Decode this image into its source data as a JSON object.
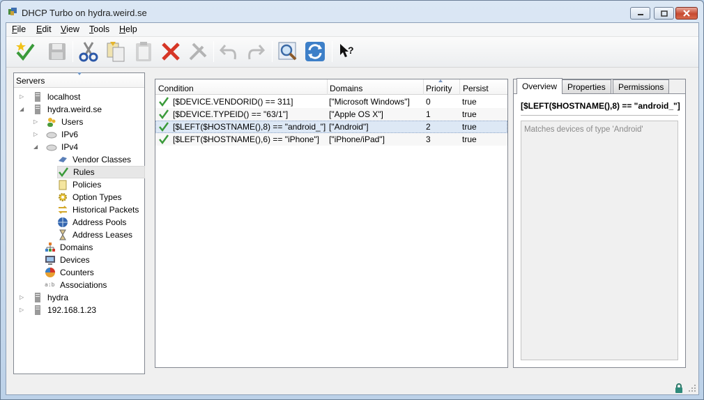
{
  "window": {
    "title": "DHCP Turbo on hydra.weird.se"
  },
  "menu": [
    "File",
    "Edit",
    "View",
    "Tools",
    "Help"
  ],
  "toolbar": [
    "apply-icon",
    "save-icon",
    "cut-icon",
    "copy-icon",
    "paste-icon",
    "delete-icon",
    "tools-icon",
    "undo-icon",
    "redo-icon",
    "search-icon",
    "refresh-icon",
    "whats-this-icon"
  ],
  "servers": {
    "header": "Servers",
    "items": [
      {
        "label": "localhost"
      },
      {
        "label": "hydra.weird.se"
      },
      {
        "label": "Users"
      },
      {
        "label": "IPv6"
      },
      {
        "label": "IPv4"
      },
      {
        "label": "Vendor Classes"
      },
      {
        "label": "Rules"
      },
      {
        "label": "Policies"
      },
      {
        "label": "Option Types"
      },
      {
        "label": "Historical Packets"
      },
      {
        "label": "Address Pools"
      },
      {
        "label": "Address Leases"
      },
      {
        "label": "Domains"
      },
      {
        "label": "Devices"
      },
      {
        "label": "Counters"
      },
      {
        "label": "Associations"
      },
      {
        "label": "hydra"
      },
      {
        "label": "192.168.1.23"
      }
    ]
  },
  "rules": {
    "columns": [
      "Condition",
      "Domains",
      "Priority",
      "Persist"
    ],
    "rows": [
      {
        "condition": "[$DEVICE.VENDORID() == 311]",
        "domains": "[\"Microsoft Windows\"]",
        "priority": "0",
        "persist": "true"
      },
      {
        "condition": "[$DEVICE.TYPEID() == \"63/1\"]",
        "domains": "[\"Apple OS X\"]",
        "priority": "1",
        "persist": "true"
      },
      {
        "condition": "[$LEFT($HOSTNAME(),8) == \"android_\"]",
        "domains": "[\"Android\"]",
        "priority": "2",
        "persist": "true"
      },
      {
        "condition": "[$LEFT($HOSTNAME(),6) == \"iPhone\"]",
        "domains": "[\"iPhone/iPad\"]",
        "priority": "3",
        "persist": "true"
      }
    ]
  },
  "detail": {
    "tabs": [
      "Overview",
      "Properties",
      "Permissions"
    ],
    "title": "[$LEFT($HOSTNAME(),8) == \"android_\"]",
    "description": "Matches devices of type 'Android'"
  },
  "colors": {
    "check": "#3a9a3a",
    "selection": "#dde8f5",
    "titlebar": "#c9dbee"
  }
}
